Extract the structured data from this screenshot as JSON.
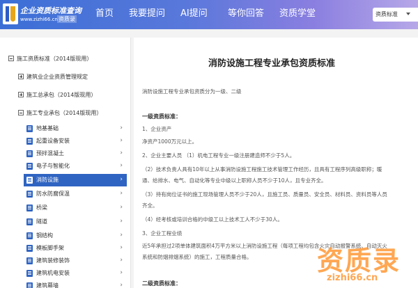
{
  "header": {
    "logo_title": "企业资质标准查询",
    "logo_url": "www.zizhi66.cn",
    "logo_brand": "资质录",
    "nav": [
      "首页",
      "我要提问",
      "AI提问",
      "等你回答",
      "资质学堂"
    ],
    "search_type": "资质标准"
  },
  "sidebar": {
    "root": "施工资质标准（2014版现用）",
    "groups": [
      "建筑业企业资质管理规定",
      "施工总承包（2014版现用）",
      "施工专业承包（2014版现用）"
    ],
    "items": [
      {
        "label": "地基基础"
      },
      {
        "label": "起重设备安装"
      },
      {
        "label": "预拌混凝土"
      },
      {
        "label": "电子与智能化"
      },
      {
        "label": "消防设施",
        "active": true
      },
      {
        "label": "防水防腐保温"
      },
      {
        "label": "桥梁"
      },
      {
        "label": "隧道"
      },
      {
        "label": "钢结构"
      },
      {
        "label": "模板脚手架"
      },
      {
        "label": "建筑装修装饰"
      },
      {
        "label": "建筑机电安装"
      },
      {
        "label": "建筑幕墙"
      }
    ]
  },
  "doc": {
    "title": "消防设施工程专业承包资质标准",
    "intro": "消防设施工程专业承包资质分为一级、二级",
    "h1": "一级资质标准：",
    "s1": "1、企业资产",
    "s1_text": "净资产1000万元以上。",
    "s2": "2、企业主要人员 （1）机电工程专业一级注册建造师不少于5人。",
    "s2_2a": "（2）技术负责人具有10年以上从事消防设施工程施工技术管理工作经历，且具有工程序列高级职称；暖",
    "s2_2b": "通、给排水、电气、自动化等专业中级以上职称人员不少于10人，且专业齐全。",
    "s2_3a": "（3）持有岗位证书的施工现场管理人员不少于20人，且施工员、质量员、安全员、材料员、资料员等人员",
    "s2_3b": "齐全。",
    "s2_4": "（4）经考核或培训合格的中级工以上技术工人不少于30人。",
    "s3": "3、企业工程业绩",
    "s3_a": "近5年承担过2项单体建筑面积4万平方米以上消防设施工程（每项工程均包含火灾自动报警系统、自动灭火",
    "s3_b": "系统和防烟排烟系统）的施工，工程质量合格。",
    "h2": "二级资质标准："
  },
  "watermark": {
    "cn": "资质录",
    "url": "zizhi66.cn"
  },
  "colors": {
    "header_start": "#3b6fd6",
    "header_end": "#b7a8e8",
    "active_item": "#2f64c2",
    "watermark": "#ff8a1a"
  }
}
